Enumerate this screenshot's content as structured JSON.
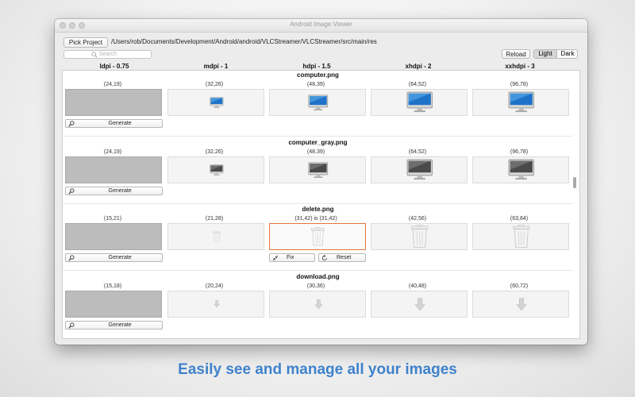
{
  "window": {
    "title": "Android Image Viewer"
  },
  "toolbar": {
    "pick_label": "Pick Project",
    "path": "/Users/rob/Documents/Development/Android/android/VLCStreamer/VLCStreamer/src/main/res",
    "search_placeholder": "Search",
    "reload_label": "Reload",
    "theme": {
      "light": "Light",
      "dark": "Dark",
      "selected": "Light"
    }
  },
  "columns": [
    "ldpi - 0.75",
    "mdpi - 1",
    "hdpi - 1.5",
    "xhdpi - 2",
    "xxhdpi - 3"
  ],
  "buttons": {
    "generate": "Generate",
    "fix": "Fix",
    "reset": "Reset"
  },
  "sections": [
    {
      "name": "computer.png",
      "icon": "monitor-color-icon",
      "sizes": [
        "(24,19)",
        "(32,26)",
        "(48,39)",
        "(64,52)",
        "(96,78)"
      ]
    },
    {
      "name": "computer_gray.png",
      "icon": "monitor-gray-icon",
      "sizes": [
        "(24,19)",
        "(32,26)",
        "(48,39)",
        "(64,52)",
        "(96,78)"
      ]
    },
    {
      "name": "delete.png",
      "icon": "trash-icon",
      "sizes": [
        "(15,21)",
        "(21,28)",
        "(31,42)  is (31,42)",
        "(42,56)",
        "(63,84)"
      ]
    },
    {
      "name": "download.png",
      "icon": "down-arrow-icon",
      "sizes": [
        "(15,18)",
        "(20,24)",
        "(30,36)",
        "(40,48)",
        "(60,72)"
      ]
    }
  ],
  "caption": "Easily see and manage all your images",
  "colors": {
    "accent": "#3f82cc",
    "selection": "#e2763f"
  }
}
